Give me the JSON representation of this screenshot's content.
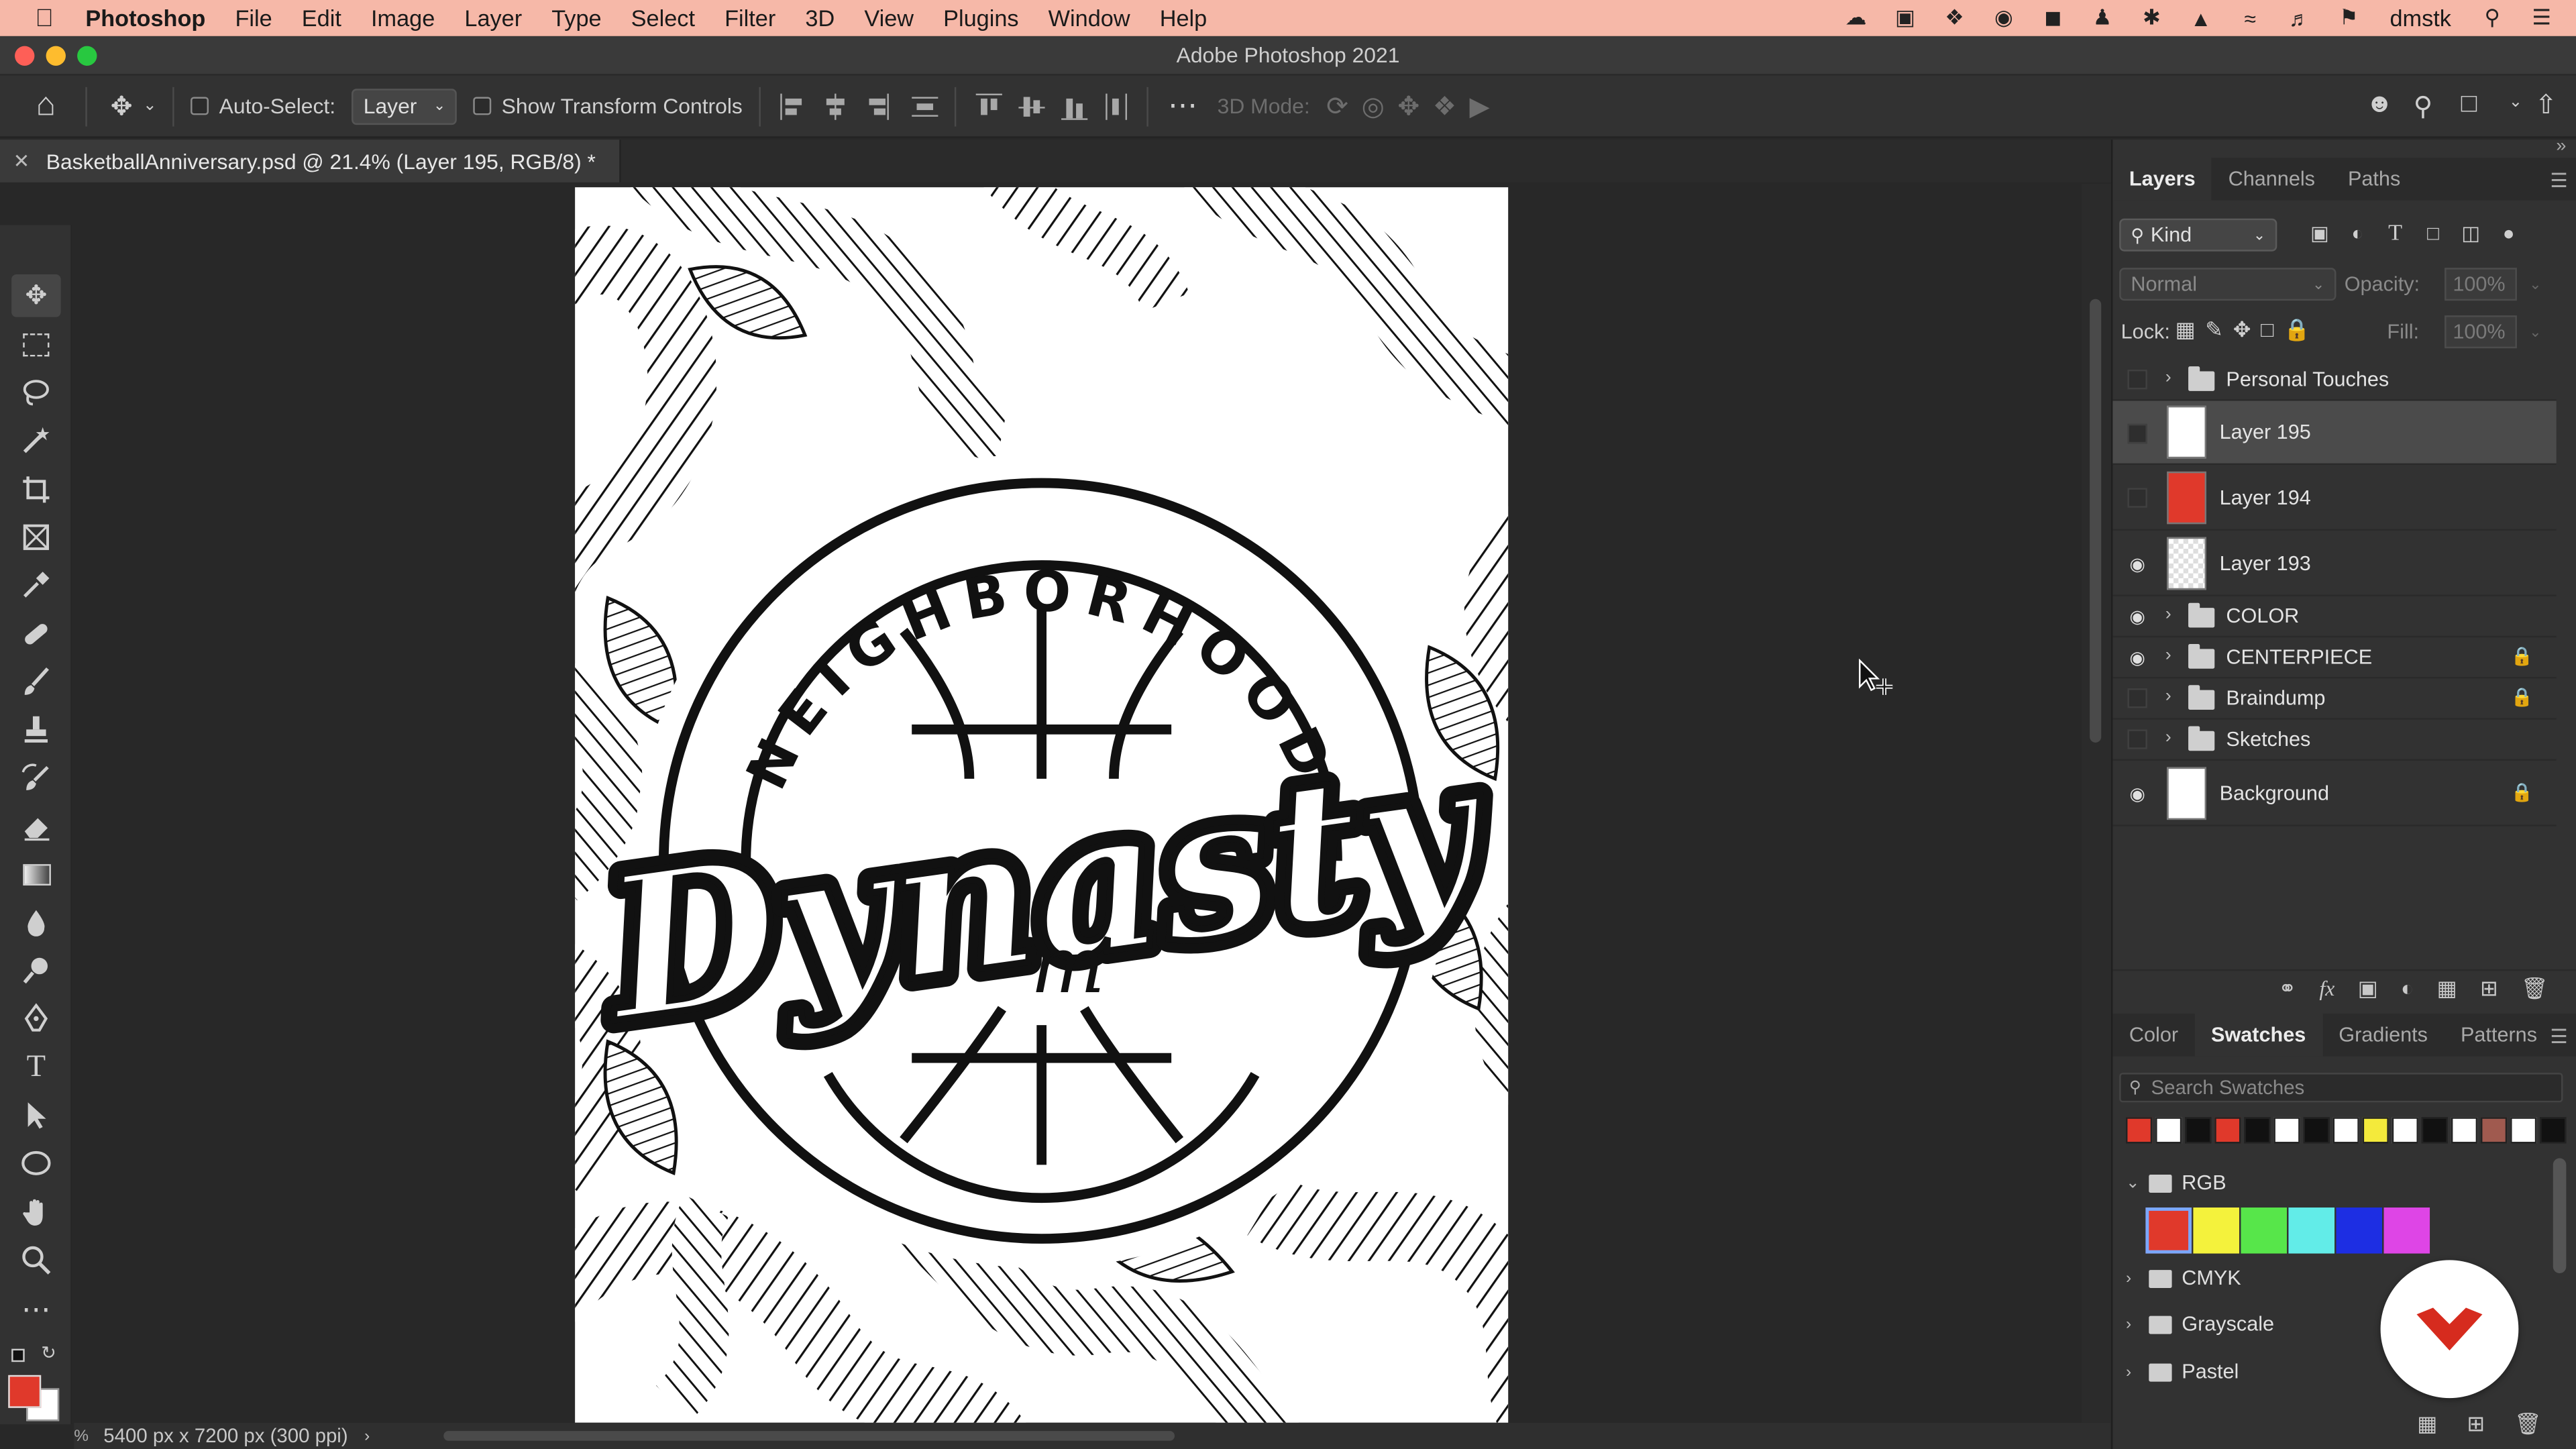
{
  "menubar": {
    "app": "Photoshop",
    "items": [
      "File",
      "Edit",
      "Image",
      "Layer",
      "Type",
      "Select",
      "Filter",
      "3D",
      "View",
      "Plugins",
      "Window",
      "Help"
    ],
    "user": "dmstk"
  },
  "window": {
    "title": "Adobe Photoshop 2021"
  },
  "options": {
    "auto_select_label": "Auto-Select:",
    "auto_select_value": "Layer",
    "show_transform_label": "Show Transform Controls",
    "mode_3d_label": "3D Mode:"
  },
  "document": {
    "tab_label": "BasketballAnniversary.psd @ 21.4% (Layer 195, RGB/8) *",
    "status": "5400 px x 7200 px (300 ppi)"
  },
  "layers_panel": {
    "tabs": [
      "Layers",
      "Channels",
      "Paths"
    ],
    "filter_kind": "Kind",
    "blend_mode": "Normal",
    "opacity_label": "Opacity:",
    "opacity_value": "100%",
    "lock_label": "Lock:",
    "fill_label": "Fill:",
    "fill_value": "100%",
    "layers": [
      {
        "name": "Personal Touches",
        "type": "group",
        "visible": false,
        "locked": false
      },
      {
        "name": "Layer 195",
        "type": "layer",
        "visible": false,
        "locked": false,
        "selected": true,
        "thumb": "white"
      },
      {
        "name": "Layer 194",
        "type": "layer",
        "visible": false,
        "locked": false,
        "thumb": "#e0392b"
      },
      {
        "name": "Layer 193",
        "type": "layer",
        "visible": true,
        "locked": false,
        "thumb": "checker"
      },
      {
        "name": "COLOR",
        "type": "group",
        "visible": true,
        "locked": false
      },
      {
        "name": "CENTERPIECE",
        "type": "group",
        "visible": true,
        "locked": true
      },
      {
        "name": "Braindump",
        "type": "group",
        "visible": false,
        "locked": true
      },
      {
        "name": "Sketches",
        "type": "group",
        "visible": false,
        "locked": false
      },
      {
        "name": "Background",
        "type": "layer",
        "visible": true,
        "locked": true,
        "thumb": "white"
      }
    ]
  },
  "swatches_panel": {
    "tabs": [
      "Color",
      "Swatches",
      "Gradients",
      "Patterns"
    ],
    "search_placeholder": "Search Swatches",
    "recent": [
      "#e0392b",
      "#ffffff",
      "#111111",
      "#e0392b",
      "#111111",
      "#ffffff",
      "#111111",
      "#ffffff",
      "#f4ea3b",
      "#ffffff",
      "#111111",
      "#ffffff",
      "#a05a4f",
      "#ffffff",
      "#111111"
    ],
    "groups": [
      {
        "name": "RGB",
        "expanded": true,
        "colors": [
          "#e0392b",
          "#f4f23c",
          "#57e64a",
          "#62ece8",
          "#1d2ee3",
          "#de45e6"
        ]
      },
      {
        "name": "CMYK",
        "expanded": false
      },
      {
        "name": "Grayscale",
        "expanded": false
      },
      {
        "name": "Pastel",
        "expanded": false
      }
    ]
  },
  "artwork": {
    "arc_text": "NEIGHBORHOOD",
    "script_text": "Dynasty",
    "sub_text": "m"
  },
  "colors": {
    "foreground": "#e0392b",
    "background": "#ffffff",
    "brand": "#d62b1e"
  }
}
